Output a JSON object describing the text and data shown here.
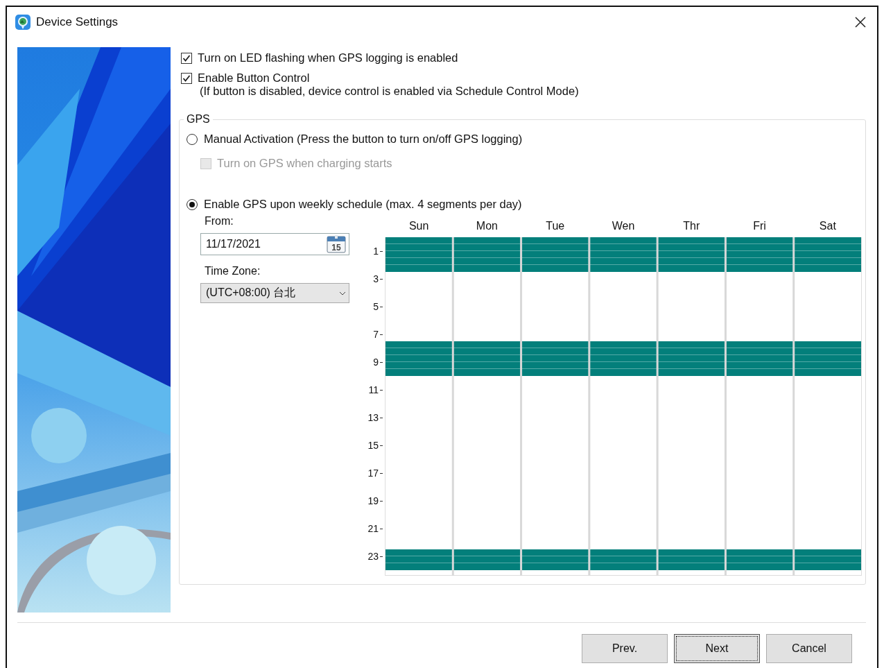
{
  "window": {
    "title": "Device Settings"
  },
  "options": [
    {
      "label": "Turn on LED flashing when GPS logging is enabled",
      "checked": true
    },
    {
      "label": "Enable Button Control",
      "checked": true,
      "note": "(If button is disabled, device control is enabled via Schedule Control Mode)"
    }
  ],
  "gps": {
    "title": "GPS",
    "modes": [
      {
        "label": "Manual Activation (Press the button to turn on/off GPS logging)",
        "selected": false,
        "suboption": {
          "label": "Turn on GPS when charging starts",
          "checked": false,
          "disabled": true
        }
      },
      {
        "label": "Enable GPS upon weekly schedule (max. 4 segments per day)",
        "selected": true
      }
    ],
    "from_label": "From:",
    "from_value": "11/17/2021",
    "calendar_icon_text": "15",
    "timezone_label": "Time Zone:",
    "timezone_value": "(UTC+08:00) 台北",
    "schedule": {
      "days": [
        "Sun",
        "Mon",
        "Tue",
        "Wen",
        "Thr",
        "Fri",
        "Sat"
      ],
      "hour_labels": [
        "1",
        "3",
        "5",
        "7",
        "9",
        "11",
        "13",
        "15",
        "17",
        "19",
        "21",
        "23"
      ],
      "half_hour_slots": [
        {
          "on": true
        },
        {
          "on": true
        },
        {
          "on": true
        },
        {
          "on": true
        },
        {
          "on": true
        },
        {
          "on": false
        },
        {
          "on": false
        },
        {
          "on": false
        },
        {
          "on": false
        },
        {
          "on": false
        },
        {
          "on": false
        },
        {
          "on": false
        },
        {
          "on": false
        },
        {
          "on": false
        },
        {
          "on": false
        },
        {
          "on": true
        },
        {
          "on": true
        },
        {
          "on": true
        },
        {
          "on": true
        },
        {
          "on": true
        },
        {
          "on": false
        },
        {
          "on": false
        },
        {
          "on": false
        },
        {
          "on": false
        },
        {
          "on": false
        },
        {
          "on": false
        },
        {
          "on": false
        },
        {
          "on": false
        },
        {
          "on": false
        },
        {
          "on": false
        },
        {
          "on": false
        },
        {
          "on": false
        },
        {
          "on": false
        },
        {
          "on": false
        },
        {
          "on": false
        },
        {
          "on": false
        },
        {
          "on": false
        },
        {
          "on": false
        },
        {
          "on": false
        },
        {
          "on": false
        },
        {
          "on": false
        },
        {
          "on": false
        },
        {
          "on": false
        },
        {
          "on": false
        },
        {
          "on": false
        },
        {
          "on": true
        },
        {
          "on": true
        },
        {
          "on": true
        }
      ]
    }
  },
  "buttons": [
    {
      "label": "Prev.",
      "focused": false
    },
    {
      "label": "Next",
      "focused": true
    },
    {
      "label": "Cancel",
      "focused": false
    }
  ]
}
